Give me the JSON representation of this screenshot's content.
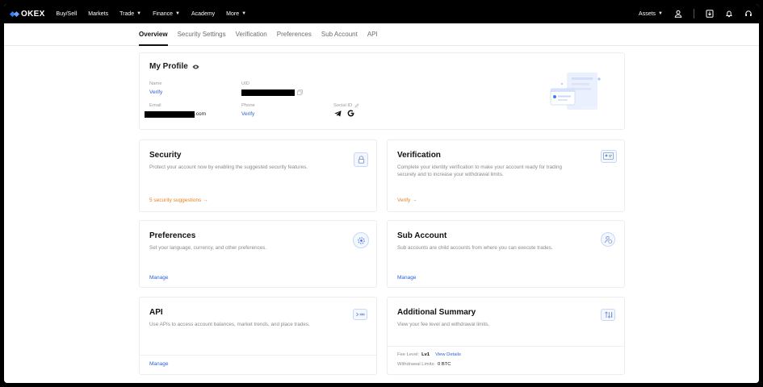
{
  "topnav": {
    "brand": "OKEX",
    "items": [
      {
        "label": "Buy/Sell",
        "caret": false
      },
      {
        "label": "Markets",
        "caret": false
      },
      {
        "label": "Trade",
        "caret": true
      },
      {
        "label": "Finance",
        "caret": true
      },
      {
        "label": "Academy",
        "caret": false
      },
      {
        "label": "More",
        "caret": true
      }
    ],
    "assets_label": "Assets",
    "icons": [
      "user-icon",
      "download-icon",
      "bell-icon",
      "headset-icon"
    ]
  },
  "subnav": {
    "tabs": [
      "Overview",
      "Security Settings",
      "Verification",
      "Preferences",
      "Sub Account",
      "API"
    ],
    "active": "Overview"
  },
  "profile": {
    "title": "My Profile",
    "name_label": "Name",
    "name_value": "Verify",
    "uid_label": "UID",
    "email_label": "Email",
    "email_suffix": ".com",
    "phone_label": "Phone",
    "phone_value": "Verify",
    "social_label": "Social ID",
    "social_icons": [
      "telegram-icon",
      "google-icon"
    ]
  },
  "cards": {
    "security": {
      "title": "Security",
      "desc": "Protect your account now by enabling the suggested security features.",
      "link": "5 security suggestions →",
      "icon": "lock-icon"
    },
    "verification": {
      "title": "Verification",
      "desc": "Complete your identity verification to make your account ready for trading securely and to increase your withdrawal limits.",
      "link": "Verify →",
      "icon": "id-card-icon"
    },
    "preferences": {
      "title": "Preferences",
      "desc": "Set your language, currency, and other preferences.",
      "link": "Manage",
      "icon": "gear-icon"
    },
    "subaccount": {
      "title": "Sub Account",
      "desc": "Sub accounts are child accounts from where you can execute trades.",
      "link": "Manage",
      "icon": "users-icon"
    },
    "api": {
      "title": "API",
      "desc": "Use APIs to access account balances, market trends, and place trades.",
      "link": "Manage",
      "icon": "terminal-icon"
    },
    "summary": {
      "title": "Additional Summary",
      "desc": "View your fee level and withdrawal limits.",
      "fee_label": "Fee Level:",
      "fee_value": "Lv1",
      "fee_link": "View Details",
      "withdraw_label": "Withdrawal Limits:",
      "withdraw_value": "0 BTC",
      "icon": "sort-icon"
    }
  },
  "colors": {
    "accent": "#2b62d9",
    "warning": "#e8821f",
    "nav_bg": "#000000"
  }
}
